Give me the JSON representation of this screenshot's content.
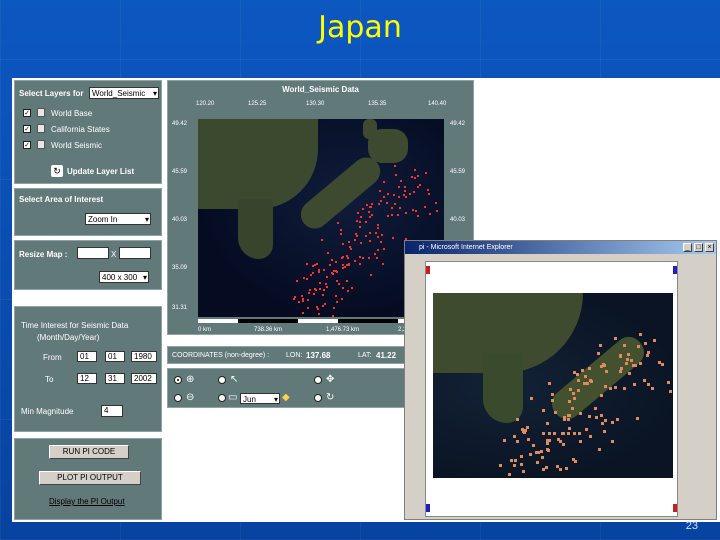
{
  "slide": {
    "title": "Japan",
    "page_number": "23"
  },
  "layers": {
    "header": "Select Layers for",
    "dataset_select": "World_Seismic",
    "items": [
      {
        "label": "World Base",
        "checked": true
      },
      {
        "label": "California States",
        "checked": true
      },
      {
        "label": "World Seismic",
        "checked": true
      }
    ],
    "update_label": "Update Layer List"
  },
  "area": {
    "header": "Select Area of Interest",
    "select_value": "Zoom In"
  },
  "resize": {
    "label": "Resize Map :",
    "x_sep": "X",
    "size_select": "400 x 300"
  },
  "time": {
    "title_line1": "Time Interest for Seismic Data",
    "title_line2": "(Month/Day/Year)",
    "from_label": "From",
    "from_values": [
      "01",
      "01",
      "1980"
    ],
    "to_label": "To",
    "to_values": [
      "12",
      "31",
      "2002"
    ],
    "magnitude_label": "Min Magnitude",
    "magnitude_value": "4"
  },
  "actions": {
    "run_label": "RUN PI CODE",
    "plot_label": "PLOT PI OUTPUT",
    "display_link": "Display the PI Output"
  },
  "map": {
    "title": "World_Seismic Data",
    "top_ticks": [
      "120.20",
      "125.25",
      "130.30",
      "135.35",
      "140.40"
    ],
    "left_ticks": [
      "49.42",
      "45.59",
      "40.03",
      "35.09",
      "31.31"
    ],
    "right_ticks": [
      "49.42",
      "45.59",
      "40.03"
    ],
    "scale_labels": [
      "0 km",
      "738.36 km",
      "1,476.73 km",
      "2,215.09"
    ],
    "coord_label": "COORDINATES (non-degree) :",
    "lon_label": "LON:",
    "lon_value": "137.68",
    "lat_label": "LAT:",
    "lat_value": "41.22",
    "tool_select": "Jun"
  },
  "popup": {
    "title": "pi - Microsoft Internet Explorer"
  },
  "colors": {
    "background": "#0a4fb0",
    "title": "#ffff00",
    "panel": "#627979",
    "quake": "#ff3030",
    "pi_point": "#e08a60"
  }
}
